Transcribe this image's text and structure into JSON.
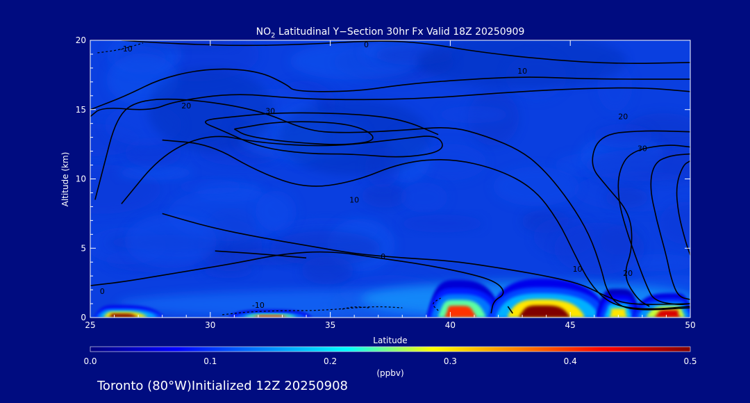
{
  "chart_data": {
    "type": "heatmap",
    "title_pre": "NO",
    "title_sub": "2",
    "title_post": " Latitudinal Y−Section 30hr  Fx Valid 18Z 20250909",
    "xlabel": "Latitude",
    "ylabel": "Altitude (km)",
    "xlim": [
      25,
      50
    ],
    "ylim": [
      0,
      20
    ],
    "x_ticks": [
      "25",
      "30",
      "35",
      "40",
      "45",
      "50"
    ],
    "y_ticks": [
      "0",
      "5",
      "10",
      "15",
      "20"
    ],
    "colorbar": {
      "label": "(ppbv)",
      "range": [
        0.0,
        0.5
      ],
      "ticks": [
        "0.0",
        "0.1",
        "0.2",
        "0.3",
        "0.4",
        "0.5"
      ],
      "colors": [
        "#000080",
        "#0000ff",
        "#0080ff",
        "#00ffff",
        "#ffff00",
        "#ff8000",
        "#ff0000",
        "#800000"
      ]
    },
    "background_value": 0.05,
    "surface_plumes": [
      {
        "lat_start": 25.3,
        "lat_end": 27.8,
        "peak_lat": 26.2,
        "top_km": 0.55,
        "peak_value": 0.5
      },
      {
        "lat_start": 31.0,
        "lat_end": 34.0,
        "peak_lat": 32.5,
        "top_km": 0.35,
        "peak_value": 0.4
      },
      {
        "lat_start": 39.2,
        "lat_end": 41.9,
        "peak_lat": 40.3,
        "top_km": 1.7,
        "peak_value": 0.4
      },
      {
        "lat_start": 41.9,
        "lat_end": 46.2,
        "peak_lat": 43.8,
        "top_km": 1.75,
        "peak_value": 0.5
      },
      {
        "lat_start": 46.2,
        "lat_end": 47.8,
        "peak_lat": 47.0,
        "top_km": 1.3,
        "peak_value": 0.3
      },
      {
        "lat_start": 47.8,
        "lat_end": 50.0,
        "peak_lat": 49.2,
        "top_km": 1.1,
        "peak_value": 0.45
      }
    ],
    "contour_labels": [
      {
        "text": "-10",
        "lat": 26.5,
        "alt": 19.4
      },
      {
        "text": "0",
        "lat": 36.5,
        "alt": 19.7
      },
      {
        "text": "10",
        "lat": 43.0,
        "alt": 17.8
      },
      {
        "text": "20",
        "lat": 29.0,
        "alt": 15.3
      },
      {
        "text": "30",
        "lat": 32.5,
        "alt": 14.9
      },
      {
        "text": "20",
        "lat": 47.2,
        "alt": 14.5
      },
      {
        "text": "30",
        "lat": 48.0,
        "alt": 12.2
      },
      {
        "text": "10",
        "lat": 36.0,
        "alt": 8.5
      },
      {
        "text": "0",
        "lat": 37.2,
        "alt": 4.4
      },
      {
        "text": "10",
        "lat": 45.3,
        "alt": 3.5
      },
      {
        "text": "20",
        "lat": 47.4,
        "alt": 3.2
      },
      {
        "text": "0",
        "lat": 25.5,
        "alt": 1.9
      },
      {
        "text": "-10",
        "lat": 32.0,
        "alt": 0.9
      }
    ],
    "contours": [
      {
        "style": "solid",
        "points": [
          [
            26.3,
            20
          ],
          [
            28,
            19.8
          ],
          [
            31,
            19.6
          ],
          [
            34,
            19.7
          ],
          [
            37,
            20
          ],
          [
            39,
            19.8
          ],
          [
            41,
            19.2
          ],
          [
            44,
            18.6
          ],
          [
            47,
            18.3
          ],
          [
            50,
            18.4
          ]
        ]
      },
      {
        "style": "solid",
        "points": [
          [
            25,
            15.0
          ],
          [
            26.5,
            16.0
          ],
          [
            28,
            17.3
          ],
          [
            30,
            18.0
          ],
          [
            32,
            17.8
          ],
          [
            33.2,
            16.8
          ],
          [
            33.5,
            16.3
          ],
          [
            36,
            16.3
          ],
          [
            38,
            16.8
          ],
          [
            40,
            17.1
          ],
          [
            43,
            17.4
          ],
          [
            46,
            17.2
          ],
          [
            50,
            17.2
          ]
        ]
      },
      {
        "style": "solid",
        "points": [
          [
            25,
            14.5
          ],
          [
            25.5,
            15.2
          ],
          [
            27.5,
            14.9
          ],
          [
            28.5,
            15.6
          ],
          [
            31,
            16.2
          ],
          [
            33.5,
            15.8
          ],
          [
            36,
            15.7
          ],
          [
            39,
            15.8
          ],
          [
            42,
            16.2
          ],
          [
            45,
            16.5
          ],
          [
            48,
            16.6
          ],
          [
            50,
            16.3
          ]
        ]
      },
      {
        "style": "solid",
        "points": [
          [
            25.2,
            8.5
          ],
          [
            25.5,
            10.5
          ],
          [
            26.1,
            14.5
          ],
          [
            27,
            15.7
          ],
          [
            29,
            15.8
          ],
          [
            32,
            15.0
          ],
          [
            34,
            13.5
          ],
          [
            35.5,
            13.3
          ],
          [
            38,
            13.5
          ],
          [
            40,
            13.8
          ],
          [
            41.5,
            13.1
          ],
          [
            43,
            12.0
          ],
          [
            44,
            10.5
          ],
          [
            45,
            8.3
          ],
          [
            45.8,
            6.0
          ],
          [
            46.3,
            3.5
          ],
          [
            46.5,
            2.0
          ],
          [
            47,
            0.8
          ],
          [
            48,
            0.5
          ],
          [
            50,
            0.7
          ]
        ]
      },
      {
        "style": "solid",
        "points": [
          [
            28,
            12.8
          ],
          [
            30,
            12.5
          ],
          [
            32,
            10.5
          ],
          [
            34,
            9.3
          ],
          [
            36,
            9.8
          ],
          [
            38,
            11.2
          ],
          [
            40,
            11.5
          ],
          [
            42,
            10.7
          ],
          [
            43.5,
            9.3
          ],
          [
            44.5,
            7.0
          ],
          [
            45.2,
            4.5
          ],
          [
            45.8,
            2.5
          ],
          [
            46.5,
            1.2
          ],
          [
            47.3,
            0.7
          ],
          [
            48.5,
            0.6
          ],
          [
            50,
            0.8
          ]
        ]
      },
      {
        "style": "solid",
        "points": [
          [
            26.3,
            8.2
          ],
          [
            28,
            11.8
          ],
          [
            30,
            13.3
          ],
          [
            32,
            12.6
          ],
          [
            35,
            12.3
          ],
          [
            38,
            12.9
          ],
          [
            39.5,
            13.2
          ],
          [
            39.8,
            12.0
          ],
          [
            38,
            11.5
          ],
          [
            36,
            11.8
          ],
          [
            34,
            11.8
          ],
          [
            32,
            12.3
          ],
          [
            30.5,
            13.5
          ],
          [
            29.5,
            14.2
          ],
          [
            31,
            14.5
          ],
          [
            33,
            14.8
          ],
          [
            36,
            14.7
          ],
          [
            38,
            14.3
          ],
          [
            39.5,
            13.2
          ]
        ]
      },
      {
        "style": "solid",
        "points": [
          [
            31.0,
            13.6
          ],
          [
            33,
            14.2
          ],
          [
            36,
            14.0
          ],
          [
            37.1,
            12.8
          ],
          [
            35.5,
            12.4
          ],
          [
            33,
            12.7
          ],
          [
            31.5,
            13.1
          ],
          [
            31.0,
            13.6
          ]
        ]
      },
      {
        "style": "solid",
        "points": [
          [
            28.0,
            7.5
          ],
          [
            30,
            6.5
          ],
          [
            32,
            5.8
          ],
          [
            34,
            5.2
          ],
          [
            36,
            4.6
          ],
          [
            38,
            4.3
          ],
          [
            40,
            4.1
          ],
          [
            42,
            3.6
          ],
          [
            44,
            3.0
          ],
          [
            45.5,
            2.4
          ],
          [
            46.5,
            1.5
          ],
          [
            47.5,
            0.9
          ],
          [
            50,
            1.0
          ]
        ]
      },
      {
        "style": "solid",
        "points": [
          [
            25.0,
            2.3
          ],
          [
            26.5,
            2.6
          ],
          [
            28.5,
            3.2
          ],
          [
            31,
            3.9
          ],
          [
            33,
            4.6
          ],
          [
            35,
            4.8
          ],
          [
            37,
            4.3
          ],
          [
            39,
            3.8
          ],
          [
            41,
            3.1
          ],
          [
            42,
            2.5
          ],
          [
            42.3,
            1.7
          ],
          [
            41.8,
            1.2
          ],
          [
            41.7,
            0.3
          ]
        ]
      },
      {
        "style": "solid",
        "points": [
          [
            42.6,
            0.3
          ],
          [
            42.4,
            0.8
          ]
        ]
      },
      {
        "style": "solid",
        "points": [
          [
            50,
            12.3
          ],
          [
            49,
            12.5
          ],
          [
            47.5,
            12.0
          ],
          [
            47.0,
            10.5
          ],
          [
            47.0,
            8.5
          ],
          [
            47.3,
            6.5
          ],
          [
            47.8,
            4.0
          ],
          [
            48.2,
            2.2
          ],
          [
            48.5,
            1.2
          ],
          [
            49.5,
            0.9
          ],
          [
            50,
            1.0
          ]
        ]
      },
      {
        "style": "solid",
        "points": [
          [
            50,
            11.8
          ],
          [
            49.2,
            11.7
          ],
          [
            48.5,
            11.2
          ],
          [
            48.3,
            9.5
          ],
          [
            48.6,
            7.0
          ],
          [
            49,
            4.5
          ],
          [
            49.2,
            2.8
          ],
          [
            49.5,
            1.5
          ],
          [
            50,
            1.3
          ]
        ]
      },
      {
        "style": "solid",
        "points": [
          [
            50,
            11.3
          ],
          [
            49.7,
            11.0
          ],
          [
            49.4,
            9.5
          ],
          [
            49.5,
            7.5
          ],
          [
            49.8,
            5.5
          ],
          [
            50,
            4.5
          ]
        ]
      },
      {
        "style": "solid",
        "points": [
          [
            50,
            13.4
          ],
          [
            48,
            13.5
          ],
          [
            46.2,
            13.2
          ],
          [
            45.8,
            11.0
          ],
          [
            46.5,
            9.5
          ],
          [
            47.5,
            7.5
          ],
          [
            47.6,
            5.0
          ],
          [
            47.2,
            3.0
          ],
          [
            47.8,
            1.3
          ],
          [
            48.3,
            0.8
          ]
        ]
      },
      {
        "style": "solid",
        "points": [
          [
            30.2,
            4.8
          ],
          [
            32,
            4.6
          ],
          [
            34,
            4.3
          ]
        ]
      },
      {
        "style": "dashed",
        "points": [
          [
            25.3,
            19.1
          ],
          [
            26.2,
            19.3
          ],
          [
            27.2,
            19.8
          ]
        ]
      },
      {
        "style": "dashed",
        "points": [
          [
            30.5,
            0.2
          ],
          [
            31.5,
            0.4
          ],
          [
            33,
            0.5
          ],
          [
            34.5,
            0.5
          ],
          [
            36,
            0.7
          ],
          [
            37,
            0.8
          ],
          [
            38,
            0.7
          ]
        ]
      },
      {
        "style": "dashed",
        "points": [
          [
            35.5,
            0.6
          ],
          [
            36,
            0.8
          ],
          [
            36.6,
            0.7
          ]
        ]
      },
      {
        "style": "dashed",
        "points": [
          [
            39.5,
            0.5
          ],
          [
            39.2,
            1.0
          ],
          [
            39.6,
            1.4
          ]
        ]
      }
    ],
    "footer": "Toronto (80°W)Initialized 12Z 20250908"
  }
}
